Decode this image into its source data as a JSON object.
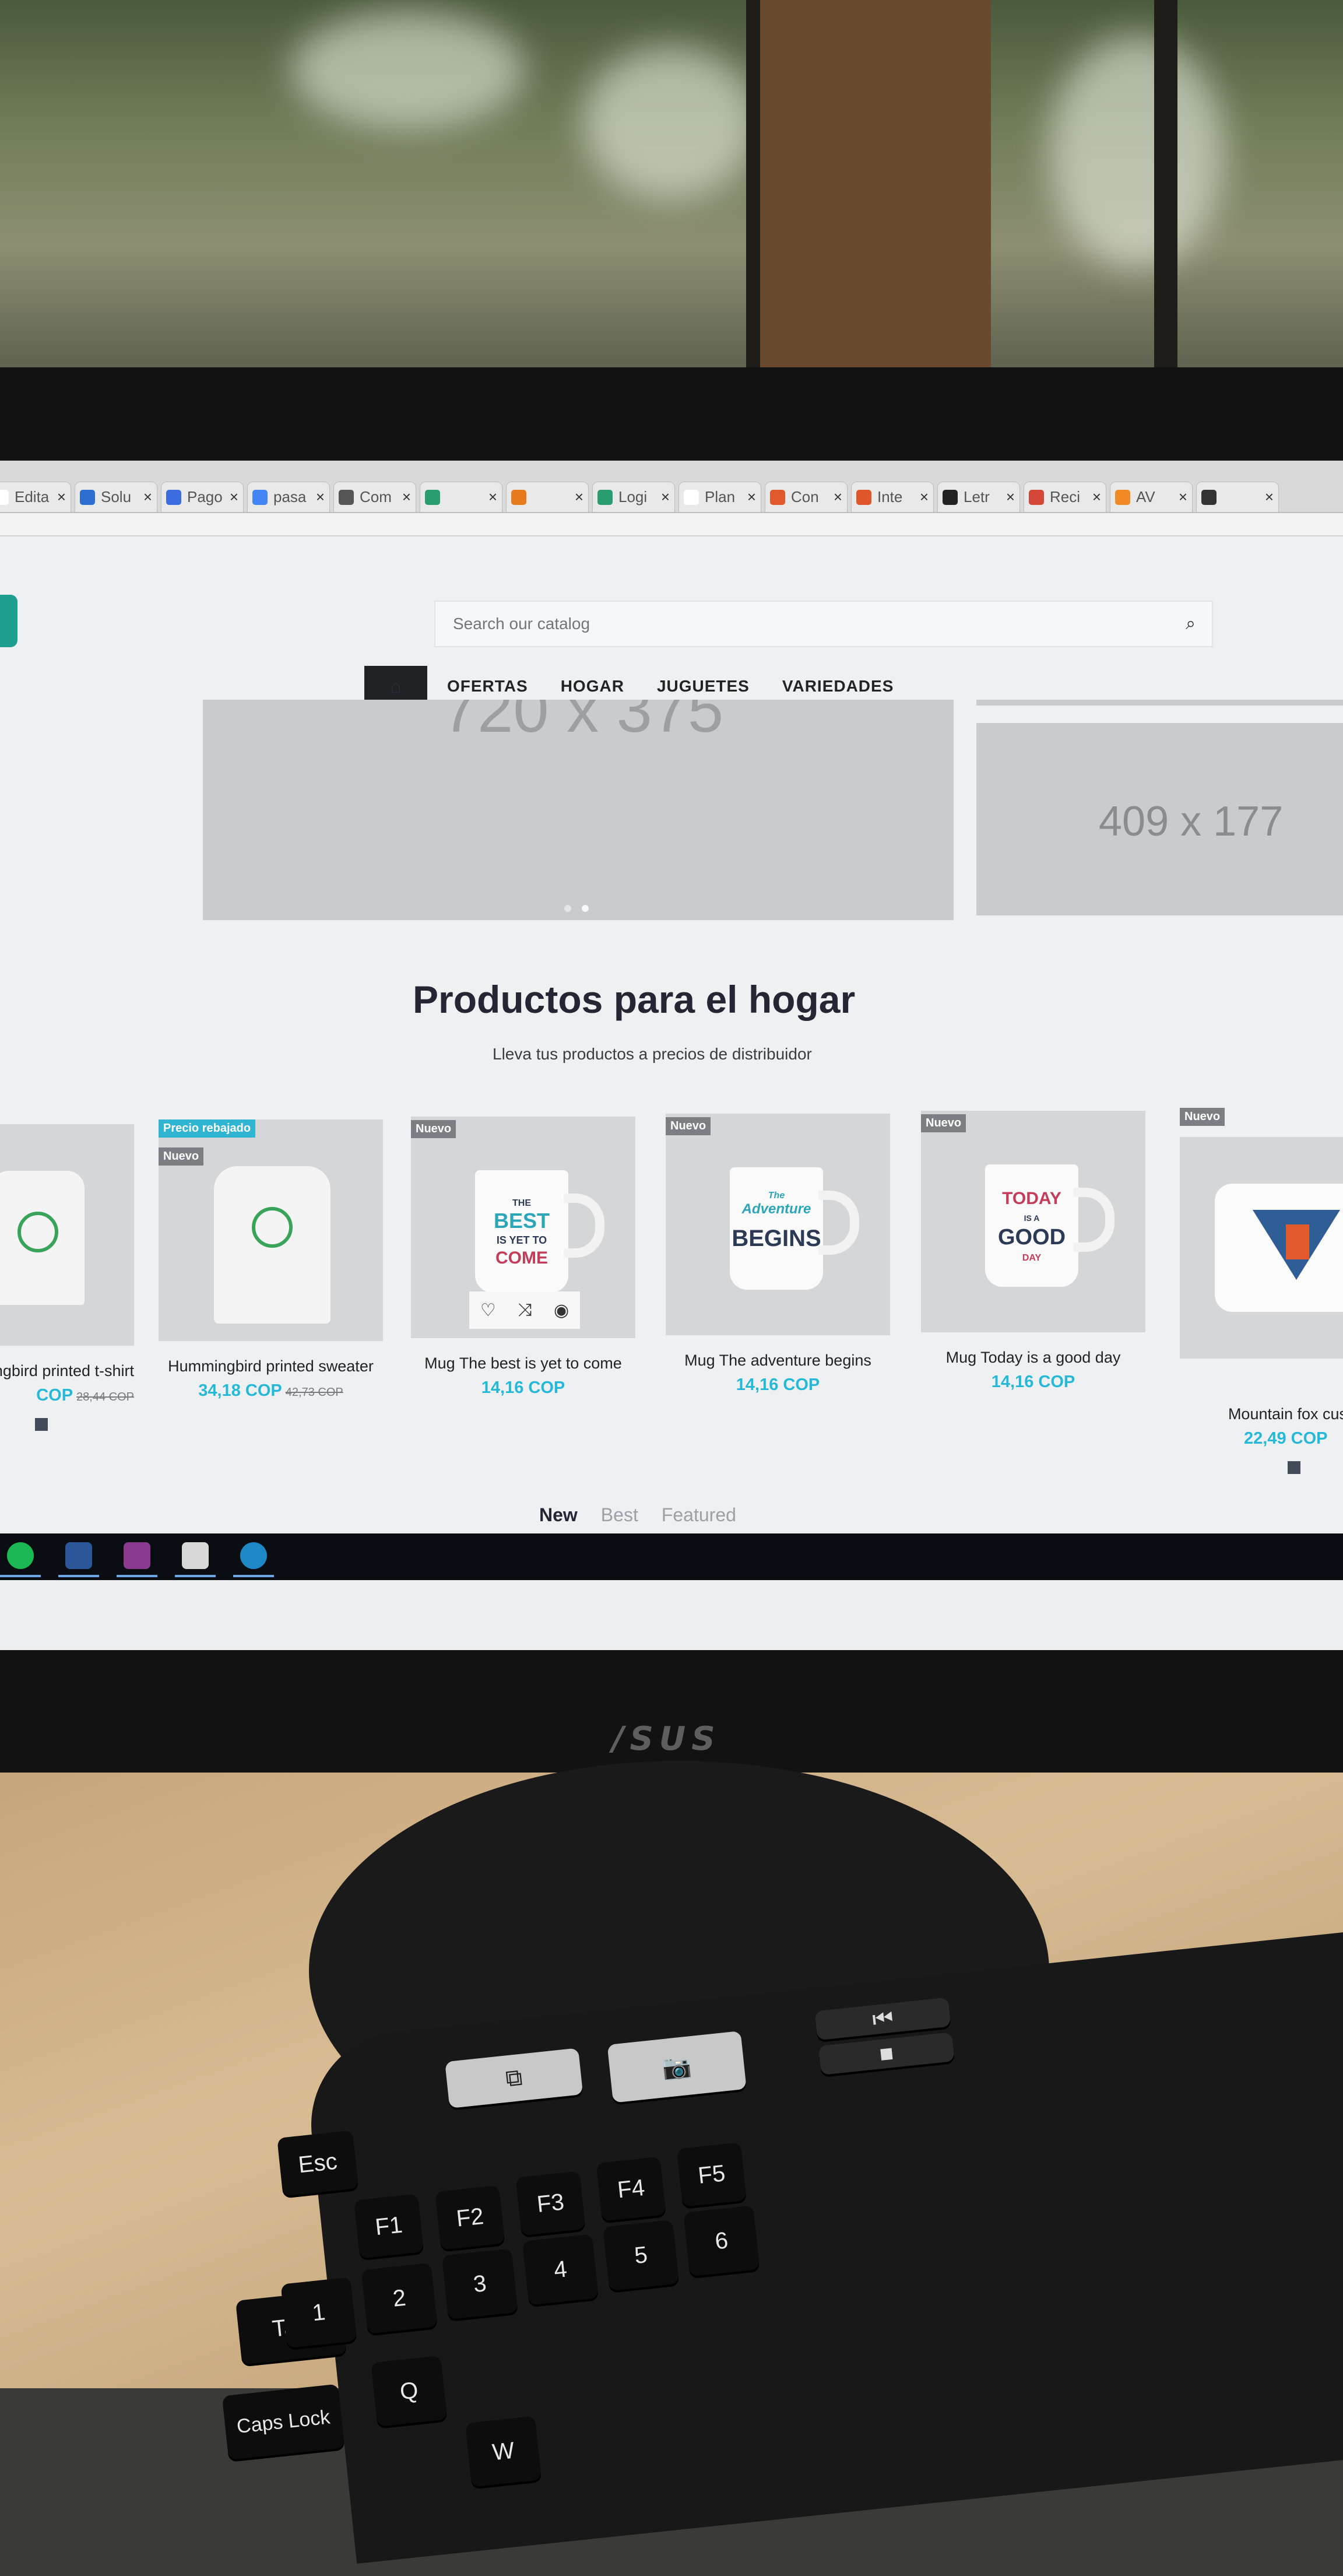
{
  "browser": {
    "tabs": [
      {
        "label": "Edita",
        "icon": "document-icon",
        "color": "#ffffff"
      },
      {
        "label": "Solu",
        "icon": "blue-square-icon",
        "color": "#2c6fd1"
      },
      {
        "label": "Pago",
        "icon": "location-pin-icon",
        "color": "#3b6de0"
      },
      {
        "label": "pasa",
        "icon": "google-icon",
        "color": "#4285f4"
      },
      {
        "label": "Com",
        "icon": "printer-icon",
        "color": "#555555"
      },
      {
        "label": "",
        "icon": "zoho-icon",
        "color": "#2a9d6e"
      },
      {
        "label": "",
        "icon": "orange-box-icon",
        "color": "#e87a1e"
      },
      {
        "label": "Logi",
        "icon": "zoho-icon",
        "color": "#2a9d6e"
      },
      {
        "label": "Plan",
        "icon": "document-icon",
        "color": "#ffffff"
      },
      {
        "label": "Con",
        "icon": "orange-box-icon",
        "color": "#e05a2b"
      },
      {
        "label": "Inte",
        "icon": "rocket-icon",
        "color": "#e0562b"
      },
      {
        "label": "Letr",
        "icon": "symfony-icon",
        "color": "#222222"
      },
      {
        "label": "Reci",
        "icon": "gmail-icon",
        "color": "#d44638"
      },
      {
        "label": "AV",
        "icon": "orange-box-icon",
        "color": "#f08a24"
      },
      {
        "label": "",
        "icon": "c-icon",
        "color": "#333333"
      }
    ]
  },
  "header": {
    "search_placeholder": "Search our catalog",
    "nav": [
      "OFERTAS",
      "HOGAR",
      "JUGUETES",
      "VARIEDADES"
    ]
  },
  "slider": {
    "main_text": "720 x 375",
    "side_text": "409 x 177",
    "slide_count": 2,
    "active_slide": 2
  },
  "section": {
    "title": "Productos para el hogar",
    "subtitle": "Lleva tus productos a precios de distribuidor"
  },
  "products": [
    {
      "name": "ngbird printed t-shirt",
      "price": "COP",
      "old_price": "28,44 COP",
      "flags": []
    },
    {
      "name": "Hummingbird printed sweater",
      "price": "34,18 COP",
      "old_price": "42,73 COP",
      "flags": [
        "Precio rebajado",
        "Nuevo"
      ]
    },
    {
      "name": "Mug The best is yet to come",
      "price": "14,16 COP",
      "old_price": "",
      "flags": [
        "Nuevo"
      ]
    },
    {
      "name": "Mug The adventure begins",
      "price": "14,16 COP",
      "old_price": "",
      "flags": [
        "Nuevo"
      ]
    },
    {
      "name": "Mug Today is a good day",
      "price": "14,16 COP",
      "old_price": "",
      "flags": [
        "Nuevo"
      ]
    },
    {
      "name": "Mountain fox cush",
      "price": "22,49 COP",
      "old_price": "",
      "flags": [
        "Nuevo"
      ]
    }
  ],
  "mug_texts": {
    "best": [
      "THE",
      "BEST",
      "IS YET TO",
      "COME"
    ],
    "adventure": [
      "The",
      "Adventure",
      "BEGINS"
    ],
    "today": [
      "TODAY",
      "IS A",
      "GOOD",
      "DAY"
    ]
  },
  "product_tabs": [
    "New",
    "Best",
    "Featured"
  ],
  "monitor_brand": "/SUS",
  "keyboard": {
    "keys": [
      "Esc",
      "F1",
      "F2",
      "F3",
      "F4",
      "F5",
      "Tab",
      "Caps Lock",
      "Q",
      "W",
      "1",
      "2",
      "3",
      "4",
      "5",
      "6"
    ],
    "alt_keys": [
      "~",
      "!",
      "@",
      "#",
      "$",
      "%",
      "^"
    ]
  },
  "colors": {
    "accent": "#25b9d7",
    "new_flag": "#7b7f83",
    "sale_flag": "#2fb5d2",
    "title": "#232734"
  }
}
